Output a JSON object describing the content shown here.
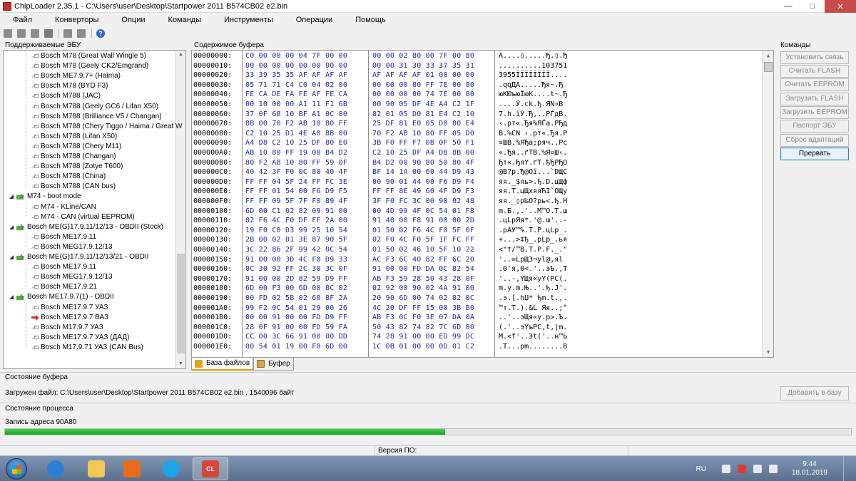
{
  "window": {
    "title": "ChipLoader 2.35.1 - C:\\Users\\user\\Desktop\\Startpower 2011 B574CB02 e2.bin"
  },
  "menu": [
    "Файл",
    "Конверторы",
    "Опции",
    "Команды",
    "Инструменты",
    "Операции",
    "Помощь"
  ],
  "toolbar": {
    "icons": [
      "tool-icon",
      "tool-icon",
      "tool-icon",
      "cut-icon",
      "tool-icon",
      "tool-icon",
      "help-icon"
    ],
    "help_glyph": "?"
  },
  "left_panel": {
    "label": "Поддерживаемые ЭБУ",
    "items": [
      {
        "label": "Bosch M78 (Great Wall Wingle 5)",
        "level": 2,
        "kind": "leaf"
      },
      {
        "label": "Bosch M78 (Geely CK2/Emgrand)",
        "level": 2,
        "kind": "leaf"
      },
      {
        "label": "Bosch ME7.9.7+ (Haima)",
        "level": 2,
        "kind": "leaf"
      },
      {
        "label": "Bosch M78 (BYD F3)",
        "level": 2,
        "kind": "leaf"
      },
      {
        "label": "Bosch M788 (JAC)",
        "level": 2,
        "kind": "leaf"
      },
      {
        "label": "Bosch M788 (Geely GC6 / Lifan X50)",
        "level": 2,
        "kind": "leaf"
      },
      {
        "label": "Bosch M788 (Brilliance V5 / Changan)",
        "level": 2,
        "kind": "leaf"
      },
      {
        "label": "Bosch M788 (Chery Tiggo / Haima / Great W",
        "level": 2,
        "kind": "leaf"
      },
      {
        "label": "Bosch M788 (Lifan X50)",
        "level": 2,
        "kind": "leaf"
      },
      {
        "label": "Bosch M788 (Chery M11)",
        "level": 2,
        "kind": "leaf"
      },
      {
        "label": "Bosch M788 (Changan)",
        "level": 2,
        "kind": "leaf"
      },
      {
        "label": "Bosch M788 (Zotye T600)",
        "level": 2,
        "kind": "leaf"
      },
      {
        "label": "Bosch M788 (China)",
        "level": 2,
        "kind": "leaf"
      },
      {
        "label": "Bosch M788 (CAN bus)",
        "level": 2,
        "kind": "leaf"
      },
      {
        "label": "M74 - boot mode",
        "level": 1,
        "kind": "folder"
      },
      {
        "label": "M74 - KLine/CAN",
        "level": 2,
        "kind": "leaf"
      },
      {
        "label": "M74 - CAN (virtual EEPROM)",
        "level": 2,
        "kind": "leaf"
      },
      {
        "label": "Bosch ME(G)17.9.11/12/13 - OBDII (Stock)",
        "level": 1,
        "kind": "folder"
      },
      {
        "label": "Bosch ME17.9.11",
        "level": 2,
        "kind": "leaf"
      },
      {
        "label": "Bosch MEG17.9.12/13",
        "level": 2,
        "kind": "leaf"
      },
      {
        "label": "Bosch ME(G)17.9.11/12/13/21 - OBDII",
        "level": 1,
        "kind": "folder"
      },
      {
        "label": "Bosch ME17.9.11",
        "level": 2,
        "kind": "leaf"
      },
      {
        "label": "Bosch MEG17.9.12/13",
        "level": 2,
        "kind": "leaf"
      },
      {
        "label": "Bosch ME17.9.21",
        "level": 2,
        "kind": "leaf"
      },
      {
        "label": "Bosch ME17.9.7(1) - OBDII",
        "level": 1,
        "kind": "folder"
      },
      {
        "label": "Bosch ME17.9.7 УАЗ",
        "level": 2,
        "kind": "leaf"
      },
      {
        "label": "Bosch ME17.9.7 ВАЗ",
        "level": 2,
        "kind": "leaf",
        "selected": true
      },
      {
        "label": "Bosch M17.9.7 УАЗ",
        "level": 2,
        "kind": "leaf"
      },
      {
        "label": "Bosch ME17.9.7 УАЗ (ДАД)",
        "level": 2,
        "kind": "leaf"
      },
      {
        "label": "Bosch M17.9.71 УАЗ (CAN Bus)",
        "level": 2,
        "kind": "leaf"
      }
    ]
  },
  "buffer": {
    "label": "Содержимое буфера",
    "rows": [
      [
        "00000000:",
        "C0 00 00 00 04 7F 00 00",
        "00 00 02 80 00 7F 00 80",
        "A....▯.....Ђ.▯.Ђ"
      ],
      [
        "00000010:",
        "00 00 00 00 00 00 00 00",
        "00 00 31 30 33 37 35 31",
        "..........103751"
      ],
      [
        "00000020:",
        "33 39 35 35 AF AF AF AF",
        "AF AF AF AF 01 00 00 00",
        "3955ЇЇЇЇЇЇЇЇ...."
      ],
      [
        "00000030:",
        "05 71 71 C4 C0 04 02 00",
        "00 00 00 80 FF 7E 00 80",
        ".qqДА.....Ђя~.Ђ"
      ],
      [
        "00000040:",
        "FE CA DE FA FE AF FE CA",
        "00 00 00 00 74 7E 00 80",
        "юКЮъюЇюК....t~.Ђ"
      ],
      [
        "00000050:",
        "00 10 00 00 A1 11 F1 6B",
        "00 90 05 DF 4E A4 C2 1F",
        "....Ў.сk.ђ.ЯN¤В"
      ],
      [
        "00000060:",
        "37 0F 68 10 BF A1 0C 80",
        "82 01 05 D0 81 E4 C2 10",
        "7.h.їЎ.Ђ,..РЃдВ."
      ],
      [
        "00000070:",
        "8B 00 70 F2 AB 10 80 FF",
        "25 DF 81 E0 05 D0 80 E4",
        "‹.pт«.Ђя%ЯЃа.РЂд"
      ],
      [
        "00000080:",
        "C2 10 25 D1 4E A0 8B 00",
        "70 F2 AB 10 80 FF 05 D0",
        "В.%СN ‹.pт«.Ђя.Р"
      ],
      [
        "00000090:",
        "A4 D8 C2 10 25 DF 80 E0",
        "3B F0 FF F7 0B 0F 50 F1",
        "¤ШВ.%ЯЂа;ряч..Pс"
      ],
      [
        "000000A0:",
        "AB 10 80 FF 19 00 B4 D2",
        "C2 10 25 DF A4 D8 8B 00",
        "«.Ђя..ґТВ.%Я¤Ш‹."
      ],
      [
        "000000B0:",
        "80 F2 AB 10 80 FF 59 0F",
        "B4 D2 00 90 80 50 80 4F",
        "Ђт«.ЂяY.ґТ.ђЂPЂO"
      ],
      [
        "000000C0:",
        "40 42 3F F0 0C 80 40 4F",
        "BF 14 1A 00 60 44 D9 43",
        "@B?р.Ђ@Oї...`DЩС"
      ],
      [
        "000000D0:",
        "FF FF 04 5F 24 FF FC 3E",
        "00 90 01 44 00 F6 D9 F4",
        "яя._$яь>.ђ.D.цЩф"
      ],
      [
        "000000E0:",
        "FF FF 01 54 00 F6 D9 F5",
        "FF FF 8E 49 60 4F D9 F3",
        "яя.T.цЩхяяЋI`OЩу"
      ],
      [
        "000000F0:",
        "FF FF 09 5F 7F F0 89 4F",
        "3F F0 FC 3C 00 90 02 48",
        "яя._▯р‰O?рь<.ђ.H"
      ],
      [
        "00000100:",
        "6D 00 C1 02 82 09 91 00",
        "00 4D 99 4F 0C 54 01 F8",
        "m.Б.‚.'..M™O.T.ш"
      ],
      [
        "00000110:",
        "02 F6 4C F0 DF FF 2A 00",
        "91 40 00 F8 91 00 00 2D",
        ".цLрЯя*.'@.ш'..-"
      ],
      [
        "00000120:",
        "19 F0 C0 D3 99 25 10 54",
        "01 50 02 F6 4C F0 5F 0F",
        ".рАУ™%.T.P.цLр_."
      ],
      [
        "00000130:",
        "2B 00 02 01 3E 87 90 5F",
        "02 F0 4C F0 5F 1F FC FF",
        "+...>‡ђ_.рLр_.ья"
      ],
      [
        "00000140:",
        "3C 22 86 2F 99 42 0C 54",
        "01 50 02 46 10 5F 10 22",
        "<\"†/™B.T.P.F._.\""
      ],
      [
        "00000150:",
        "91 00 00 3D 4C F0 D9 33",
        "AC F3 6C 40 82 FF 6C 20",
        "'..=LрЩ3¬уl@‚яl "
      ],
      [
        "00000160:",
        "0C 30 92 FF 2C 30 3C 0F",
        "91 00 00 FD DA 0C 82 54",
        ".0'я,0<.'..эЪ.‚T"
      ],
      [
        "00000170:",
        "91 00 00 2D 82 59 D9 FF",
        "AB F3 59 28 50 43 28 0F",
        "'..-‚YЩя«уY(PC(."
      ],
      [
        "00000180:",
        "6D 00 F3 00 6D 00 8C 02",
        "02 92 00 90 02 4A 91 00",
        "m.у.m.Њ..'.ђ.J'."
      ],
      [
        "00000190:",
        "00 FD 02 5B 02 68 8F 2A",
        "20 90 6D 00 74 02 82 0C",
        ".э.[.hЏ* ђm.t.‚."
      ],
      [
        "000001A0:",
        "99 F2 0C 54 01 29 00 26",
        "4C 20 DF FF 15 00 3B B0",
        "™т.T.).&L Яя..;°"
      ],
      [
        "000001B0:",
        "00 00 91 00 00 FD D9 FF",
        "AB F3 0C F0 3E 07 DA 0A",
        "..'..эЩя«у.р>.Ъ."
      ],
      [
        "000001C0:",
        "28 0F 91 00 00 FD 59 FA",
        "50 43 82 74 82 7C 6D 00",
        "(.'..эYъPC‚t‚|m."
      ],
      [
        "000001D0:",
        "CC 00 3C 66 91 00 00 DD",
        "74 28 91 00 00 ED 99 DC",
        "М.<f'..Эt('..н™Ь"
      ],
      [
        "000001E0:",
        "00 54 01 19 00 F0 6D 00",
        "1C 0B 01 00 00 0D 01 C2",
        ".T...рm........В"
      ]
    ],
    "tabs": [
      {
        "label": "База файлов",
        "active": true
      },
      {
        "label": "Буфер",
        "active": false
      }
    ]
  },
  "commands": {
    "label": "Команды",
    "buttons": [
      {
        "label": "Установить связь",
        "enabled": false
      },
      {
        "label": "Считать FLASH",
        "enabled": false
      },
      {
        "label": "Считать EEPROM",
        "enabled": false
      },
      {
        "label": "Загрузить FLASH",
        "enabled": false
      },
      {
        "label": "Загрузить EEPROM",
        "enabled": false
      },
      {
        "label": "Паспорт ЭБУ",
        "enabled": false
      },
      {
        "label": "Сброс адаптаций",
        "enabled": false
      },
      {
        "label": "Прервать",
        "enabled": true
      }
    ]
  },
  "buffer_state": {
    "label": "Состояние буфера",
    "loaded_file": "Загружен файл: C:\\Users\\user\\Desktop\\Startpower 2011 B574CB02 e2.bin , 1540096 байт",
    "add_button": "Добавить в базу"
  },
  "process_state": {
    "label": "Состояние процесса",
    "message": "Запись адреса 90A80",
    "progress": 0.52
  },
  "statusbar": {
    "version": "Версия ПО:"
  },
  "taskbar": {
    "lang": "RU",
    "time": "9:44",
    "date": "18.01.2019",
    "apps": [
      {
        "name": "internet-explorer-icon",
        "color": "#2d7fd6"
      },
      {
        "name": "file-explorer-icon",
        "color": "#f1c757"
      },
      {
        "name": "media-player-icon",
        "color": "#e86a1d"
      },
      {
        "name": "skype-icon",
        "color": "#1aa6e8"
      },
      {
        "name": "chiploader-icon",
        "color": "#d8453a"
      }
    ],
    "active_app_index": 4,
    "chiploader_badge": "CL"
  }
}
